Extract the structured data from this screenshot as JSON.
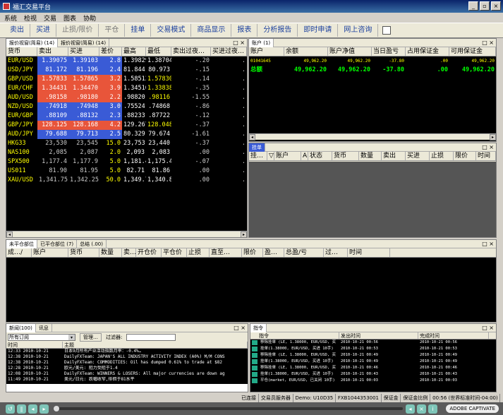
{
  "window": {
    "title": "福汇交易平台",
    "controls": [
      "_",
      "▫",
      "×"
    ]
  },
  "menu": [
    "系统",
    "检视",
    "交易",
    "图表",
    "协助"
  ],
  "toolbar": [
    "卖出",
    "买进",
    "止损/限价",
    "平仓",
    "挂单",
    "交易模式",
    "商品显示",
    "报表",
    "分析报告",
    "即时申请",
    "网上咨询"
  ],
  "toolbar_dim": [
    "止损/限价",
    "平仓"
  ],
  "quotes": {
    "tabs": [
      "报价视窗(简易) (14)",
      "报价视窗(简易) (14)"
    ],
    "columns": [
      "货币",
      "卖出",
      "买进",
      "差价",
      "最高",
      "最低",
      "卖出过夜…",
      "买进过夜…"
    ],
    "rows": [
      [
        "EUR/USD",
        "1.39075",
        "1.39103",
        "2.8",
        "1.39829",
        "1.38704",
        "-.20",
        ".",
        "b"
      ],
      [
        "USD/JPY",
        "81.172",
        "81.196",
        "2.4",
        "81.844",
        "80.973",
        "-.15",
        ".",
        "b"
      ],
      [
        "GBP/USD",
        "1.57833",
        "1.57865",
        "3.2",
        "1.58513",
        "1.57830",
        "-.14",
        ".",
        "r"
      ],
      [
        "EUR/CHF",
        "1.34431",
        "1.34470",
        "3.9",
        "1.34510",
        "1.33838",
        "-.35",
        ".",
        "r"
      ],
      [
        "AUD/USD",
        ".98158",
        ".98180",
        "2.2",
        ".98820",
        ".98116",
        "-1.55",
        ".",
        "r"
      ],
      [
        "NZD/USD",
        ".74918",
        ".74948",
        "3.0",
        ".75524",
        ".74868",
        "-.86",
        ".",
        "b"
      ],
      [
        "EUR/GBP",
        ".88109",
        ".88132",
        "2.3",
        ".88233",
        ".87722",
        "-.12",
        ".",
        "b"
      ],
      [
        "GBP/JPY",
        "128.125",
        "128.168",
        "4.2",
        "129.267",
        "128.048",
        "-.37",
        ".",
        "r"
      ],
      [
        "AUD/JPY",
        "79.688",
        "79.713",
        "2.5",
        "80.329",
        "79.674",
        "-1.61",
        ".",
        "b"
      ],
      [
        "HKG33",
        "23,530",
        "23,545",
        "15.0",
        "23,753",
        "23,440",
        "-.37",
        ".",
        "k"
      ],
      [
        "NAS100",
        "2,085",
        "2,087",
        "2.0",
        "2,093",
        "2,083",
        ".00",
        ".",
        "k"
      ],
      [
        "SPX500",
        "1,177.4",
        "1,177.9",
        "5.0",
        "1,181.4",
        "1,175.4",
        "-.07",
        ".",
        "k"
      ],
      [
        "US011",
        "81.90",
        "81.95",
        "5.0",
        "82.71",
        "81.86",
        ".00",
        ".",
        "k"
      ],
      [
        "XAU/USD",
        "1,341.75",
        "1,342.25",
        "50.0",
        "1,349.70",
        "1,340.85",
        ".00",
        ".",
        "k"
      ]
    ]
  },
  "account": {
    "tab": "账户 (1)",
    "columns": [
      "账户",
      "余额",
      "账户净值",
      "当日盈亏",
      "占用保证金",
      "可用保证金"
    ],
    "row": [
      "01041645",
      "49,962.20",
      "49,962.20",
      "-37.80",
      ".00",
      "49,962.20"
    ],
    "total": [
      "总额",
      "49,962.20",
      "49,962.20",
      "-37.80",
      ".00",
      "49,962.20"
    ]
  },
  "orders": {
    "tab": "挂单",
    "columns": [
      "挂…",
      "▽",
      "账户",
      "A",
      "状态",
      "货币",
      "数量",
      "卖出",
      "买进",
      "止损",
      "限价",
      "时间"
    ]
  },
  "positions": {
    "tabs": [
      "未平仓部位",
      "已平仓部位 (7)",
      "总结 (.00)"
    ],
    "columns": [
      "成…/",
      "账户",
      "货币",
      "数量",
      "卖…",
      "开仓价",
      "平仓价",
      "止损",
      "直至…",
      "限价",
      "盈…",
      "总盈/亏",
      "过…",
      "时间"
    ]
  },
  "news": {
    "tabs": [
      "新闻(100)",
      "讯息"
    ],
    "filter_value": "所有订阅",
    "manage_label": "管理…",
    "filter_label": "过滤器:",
    "columns": [
      "时间",
      "主题"
    ],
    "rows": [
      [
        "12:33 2010-10-21",
        "日本9月所有产业活动指数月率：-0.4%…"
      ],
      [
        "12:38 2010-10-21",
        "DailyFXTeam: JAPAN'S ALL INDUSTRY ACTIVITY INDEX (A0%) M/M CONS"
      ],
      [
        "12:38 2010-10-21",
        "DailyFXTeam: COMMODITIES: Oil has dumped 0.61% to trade at $82"
      ],
      [
        "12:28 2010-10-21",
        "欧元/美元: 阻力受阻于1.4"
      ],
      [
        "12:08 2010-10-21",
        "DailyFXTeam: WINNERS & LOSERS: All major currencies are down ag"
      ],
      [
        "11:49 2010-10-21",
        "美元/日元: 跌幅收窄,徘徊于81水平"
      ]
    ]
  },
  "history": {
    "tab": "指令",
    "columns": [
      "指令",
      "发出时间",
      "完成时间"
    ],
    "rows": [
      [
        "移除挂单 (LE, 1.38000, EUR/USD, 买",
        "2010-10-21 00:56",
        "2010-10-21 00:56"
      ],
      [
        "挂单(1.38000, EUR/USD, 买进 10手)",
        "2010-10-21 00:53",
        "2010-10-21 00:53"
      ],
      [
        "移除挂单 (LE, 1.38000, EUR/USD, 买",
        "2010-10-21 00:49",
        "2010-10-21 00:49"
      ],
      [
        "挂单(1.38000, EUR/USD, 买进 10手)",
        "2010-10-21 00:49",
        "2010-10-21 00:49"
      ],
      [
        "移除挂单 (LE, 1.38000, EUR/USD, 买",
        "2010-10-21 00:46",
        "2010-10-21 00:46"
      ],
      [
        "挂单(1.38000, EUR/USD, 买进 10手)",
        "2010-10-21 00:43",
        "2010-10-21 00:43"
      ],
      [
        "平仓(market, EUR/USD, 已关闭 10手)",
        "2010-10-21 00:03",
        "2010-10-21 00:03"
      ]
    ]
  },
  "status": [
    "已连接",
    "交易员服务器",
    "Demo: U10D35",
    "FXB1044353001",
    "保证金",
    "保证金比例",
    "00:56 (世界标准时间-04:00)"
  ],
  "player": {
    "adobe_label": "ADOBE CAPTIVATE"
  },
  "colors": {
    "sell_red": "#e8553a",
    "buy_blue": "#3a5bd6",
    "symbol_yellow": "#ffff00",
    "account_green": "#00ff00"
  }
}
